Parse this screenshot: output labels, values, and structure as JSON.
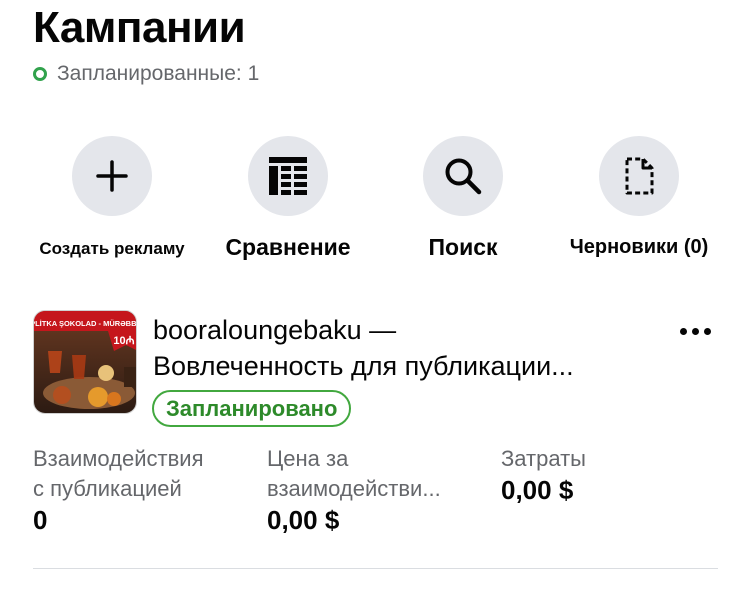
{
  "header": {
    "title": "Кампании",
    "scheduled_status": "Запланированные: 1"
  },
  "actions": [
    {
      "label": "Создать рекламу",
      "icon": "plus-icon"
    },
    {
      "label": "Сравнение",
      "icon": "compare-table-icon"
    },
    {
      "label": "Поиск",
      "icon": "search-icon"
    },
    {
      "label": "Черновики (0)",
      "icon": "draft-document-icon"
    }
  ],
  "campaign": {
    "title_line1": "booraloungebaku —",
    "title_line2": "Вовлеченность для публикации...",
    "status_badge": "Запланировано",
    "thumbnail_text": {
      "line1": "PLİTKA ŞOKOLAD - MÜRƏBBƏ",
      "price": "10₼"
    },
    "metrics": [
      {
        "label_line1": "Взаимодействия",
        "label_line2": "с публикацией",
        "value": "0"
      },
      {
        "label_line1": "Цена за",
        "label_line2": "взаимодействи...",
        "value": "0,00 $"
      },
      {
        "label_line1": "Затраты",
        "label_line2": "",
        "value": "0,00 $"
      }
    ]
  },
  "colors": {
    "scheduled_green": "#31a24c",
    "badge_green": "#2d8a2a",
    "icon_circle_bg": "#e4e6eb",
    "secondary_text": "#65676b"
  }
}
